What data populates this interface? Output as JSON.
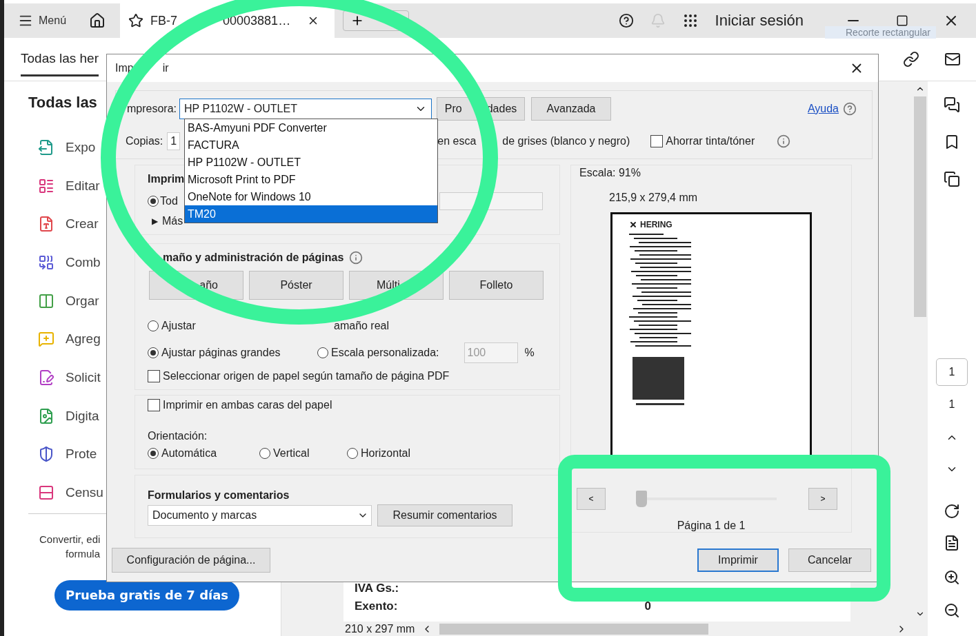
{
  "app_bar": {
    "menu": "Menú",
    "tab_title": "FB-7",
    "tab_title_rest": "00003881…",
    "sign_in": "Iniciar sesión",
    "tooltip": "Recorte rectangular"
  },
  "toolbar": {
    "tab": "Todas las her"
  },
  "tools_panel": {
    "title": "Todas las",
    "items": [
      {
        "label": "Expo",
        "color": "#1f9a8a"
      },
      {
        "label": "Editar",
        "color": "#d9367c"
      },
      {
        "label": "Crear",
        "color": "#e0474c"
      },
      {
        "label": "Comb",
        "color": "#5b5bd6"
      },
      {
        "label": "Orgar",
        "color": "#43a047"
      },
      {
        "label": "Agreg",
        "color": "#e8b300"
      },
      {
        "label": "Solicit",
        "color": "#b13fc4"
      },
      {
        "label": "Digita",
        "color": "#2e9e4f"
      },
      {
        "label": "Prote",
        "color": "#4a56c8"
      },
      {
        "label": "Censu",
        "color": "#d9367c"
      }
    ],
    "promo_lines": [
      "Convertir, edi",
      "formula"
    ],
    "trial_button": "Prueba gratis de 7 días"
  },
  "document": {
    "rows": [
      {
        "label": "IVA Gs.:"
      },
      {
        "label": "Exento:",
        "value": "0"
      }
    ],
    "page_size": "210 x 297 mm"
  },
  "right_sidebar": {
    "page_field": "1",
    "page_count": "1"
  },
  "print_dialog": {
    "title_parts": [
      "Imp",
      "ir"
    ],
    "printer_label": "mpresora:",
    "printer": "HP P1102W - OUTLET",
    "properties_button": [
      "Pro",
      "dades"
    ],
    "advanced_button": "Avanzada",
    "help_link": "Ayuda",
    "copies_label": "Copias:",
    "copies": "1",
    "grayscale_parts": [
      "en esca",
      "de grises (blanco y negro)"
    ],
    "save_ink": {
      "label": "Ahorrar tinta/tóner",
      "checked": false
    },
    "pages": {
      "title": "Imprim",
      "option": {
        "label": "Tod",
        "selected": true
      },
      "more_arrow": "▶",
      "more": "Más"
    },
    "sizing": {
      "title": "maño y administración de páginas",
      "modes": [
        "año",
        "Póster",
        "Múlti",
        "Folleto"
      ],
      "covered_option_label": "amaño real",
      "scaling": [
        {
          "label": "Ajustar",
          "selected": false
        },
        {
          "label": "Ajustar páginas grandes",
          "selected": true
        },
        {
          "label": "Escala personalizada:",
          "selected": false
        }
      ],
      "scale_value": "100",
      "scale_unit": "%",
      "paper_source": {
        "label": "Seleccionar origen de papel según tamaño de página PDF",
        "checked": false
      }
    },
    "duplex": {
      "label": "Imprimir en ambas caras del papel",
      "checked": false
    },
    "orientation": {
      "label": "Orientación:",
      "options": [
        {
          "label": "Automática",
          "selected": true
        },
        {
          "label": "Vertical",
          "selected": false
        },
        {
          "label": "Horizontal",
          "selected": false
        }
      ]
    },
    "forms": {
      "title": "Formularios y comentarios",
      "value": "Documento y marcas",
      "summarize_button": "Resumir comentarios"
    },
    "page_setup_button": "Configuración de página...",
    "preview": {
      "scale": "Escala:  91%",
      "size": "215,9 x 279,4 mm",
      "brand": "HERING",
      "prev": "<",
      "next": ">",
      "page_slider": {
        "level": 0
      },
      "page_label": "Página 1 de 1"
    },
    "print_button": "Imprimir",
    "cancel_button": "Cancelar",
    "printer_list": [
      {
        "label": "BAS-Amyuni PDF Converter",
        "selected": false
      },
      {
        "label": "FACTURA",
        "selected": false
      },
      {
        "label": "HP P1102W - OUTLET",
        "selected": false
      },
      {
        "label": "Microsoft Print to PDF",
        "selected": false
      },
      {
        "label": "OneNote for Windows 10",
        "selected": false
      },
      {
        "label": "TM20",
        "selected": true
      }
    ]
  }
}
